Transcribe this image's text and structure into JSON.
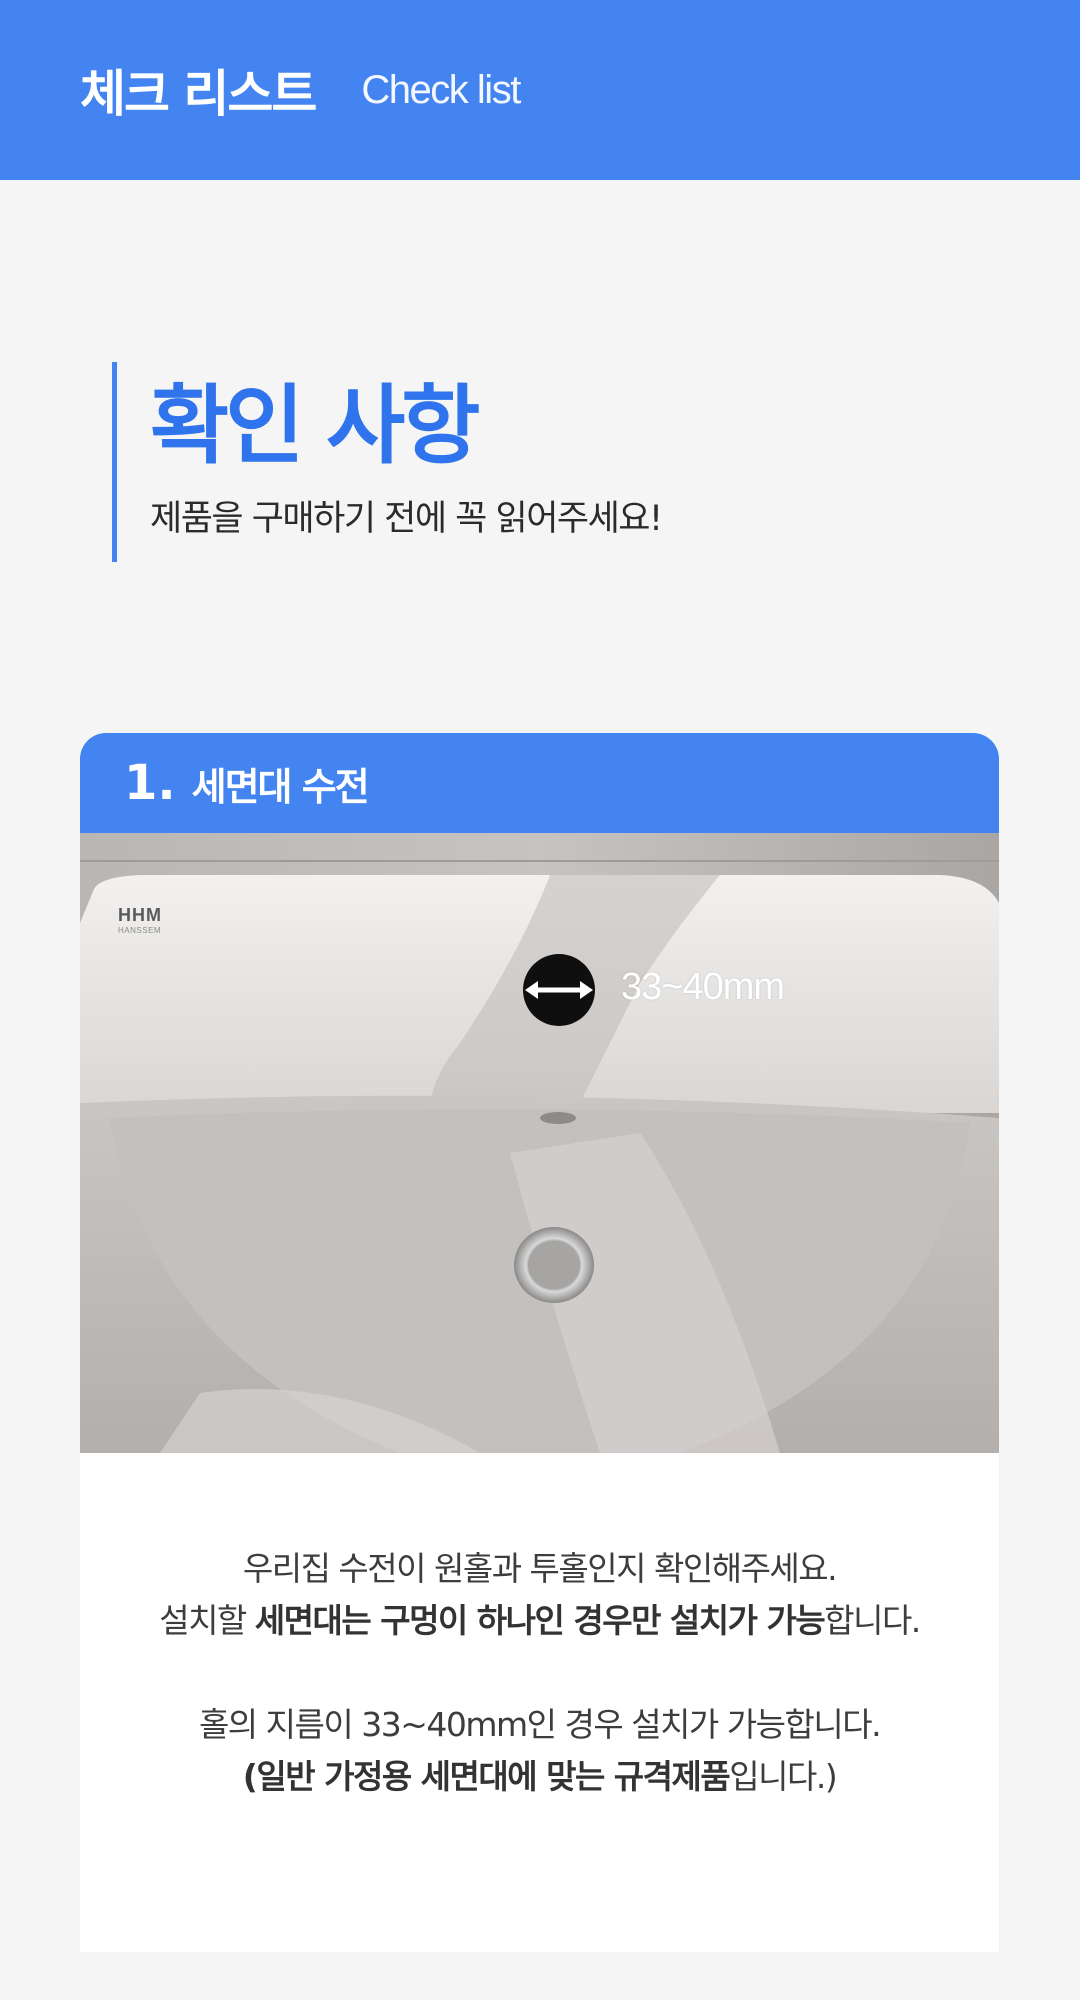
{
  "header": {
    "title": "체크 리스트",
    "subtitle": "Check list"
  },
  "heading": {
    "title": "확인 사항",
    "subtitle": "제품을 구매하기 전에 꼭 읽어주세요!"
  },
  "card": {
    "number": "1.",
    "title": "세면대 수전",
    "photo": {
      "measurement_label": "33~40mm",
      "brand_logo": "HHM",
      "brand_name": "HANSSEM"
    },
    "body": {
      "line1": "우리집 수전이 원홀과 투홀인지 확인해주세요.",
      "line2_prefix": "설치할 ",
      "line2_bold": "세면대는 구멍이 하나인 경우만 설치가 가능",
      "line2_suffix": "합니다.",
      "line3": "홀의 지름이 33~40mm인 경우 설치가 가능합니다.",
      "line4_prefix": "(",
      "line4_bold": "일반 가정용 세면대에 맞는 규격제품",
      "line4_suffix": "입니다.)"
    }
  },
  "colors": {
    "primary": "#4384f1",
    "heading_blue": "#2f74ec",
    "background": "#f5f5f5",
    "text": "#3d3d3d"
  }
}
